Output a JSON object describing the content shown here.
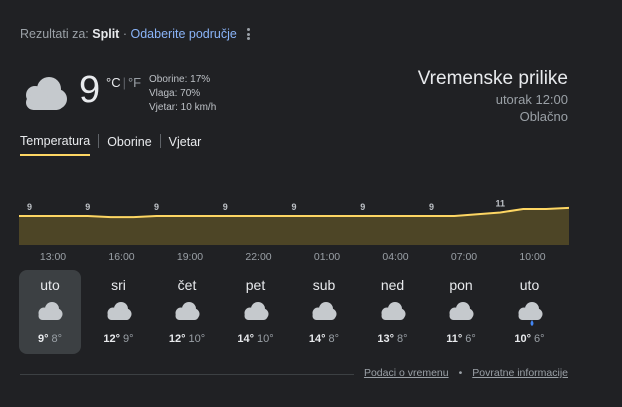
{
  "results": {
    "prefix": "Rezultati za:",
    "city": "Split",
    "separator": "·",
    "choose_area": "Odaberite područje"
  },
  "current": {
    "icon": "cloud-icon",
    "temperature": "9",
    "unit_c": "°C",
    "unit_f": "°F",
    "precipitation": "Oborine: 17%",
    "humidity": "Vlaga: 70%",
    "wind": "Vjetar: 10 km/h"
  },
  "header": {
    "title": "Vremenske prilike",
    "datetime": "utorak 12:00",
    "condition": "Oblačno"
  },
  "tabs": [
    {
      "label": "Temperatura",
      "active": true
    },
    {
      "label": "Oborine",
      "active": false
    },
    {
      "label": "Vjetar",
      "active": false
    }
  ],
  "chart_data": {
    "type": "area",
    "x": [
      "13:00",
      "14:00",
      "15:00",
      "16:00",
      "17:00",
      "18:00",
      "19:00",
      "20:00",
      "21:00",
      "22:00",
      "23:00",
      "00:00",
      "01:00",
      "02:00",
      "03:00",
      "04:00",
      "05:00",
      "06:00",
      "07:00",
      "08:00",
      "09:00",
      "10:00",
      "11:00",
      "12:00",
      "13:00"
    ],
    "series": [
      {
        "values": [
          9,
          9,
          9,
          9,
          8.7,
          8.7,
          9,
          9,
          9,
          9,
          9,
          9,
          9,
          9,
          9,
          9,
          9,
          9,
          9,
          9,
          9.5,
          10,
          11,
          11,
          11.3
        ]
      }
    ],
    "labels": [
      {
        "text": "9",
        "index": 0
      },
      {
        "text": "9",
        "index": 3
      },
      {
        "text": "9",
        "index": 6
      },
      {
        "text": "9",
        "index": 9
      },
      {
        "text": "9",
        "index": 12
      },
      {
        "text": "9",
        "index": 15
      },
      {
        "text": "9",
        "index": 18
      },
      {
        "text": "11",
        "index": 21
      }
    ],
    "tick_labels": [
      "13:00",
      "16:00",
      "19:00",
      "22:00",
      "01:00",
      "04:00",
      "07:00",
      "10:00"
    ],
    "colors": {
      "line": "#fdd663",
      "fill": "#4d4526"
    }
  },
  "days": [
    {
      "name": "uto",
      "icon": "cloud-icon",
      "hi": "9°",
      "lo": "8°",
      "selected": true
    },
    {
      "name": "sri",
      "icon": "cloud-icon",
      "hi": "12°",
      "lo": "9°",
      "selected": false
    },
    {
      "name": "čet",
      "icon": "cloud-icon",
      "hi": "12°",
      "lo": "10°",
      "selected": false
    },
    {
      "name": "pet",
      "icon": "cloud-icon",
      "hi": "14°",
      "lo": "10°",
      "selected": false
    },
    {
      "name": "sub",
      "icon": "cloud-icon",
      "hi": "14°",
      "lo": "8°",
      "selected": false
    },
    {
      "name": "ned",
      "icon": "cloud-icon",
      "hi": "13°",
      "lo": "8°",
      "selected": false
    },
    {
      "name": "pon",
      "icon": "cloud-icon",
      "hi": "11°",
      "lo": "6°",
      "selected": false
    },
    {
      "name": "uto",
      "icon": "cloud-rain-icon",
      "hi": "10°",
      "lo": "6°",
      "selected": false
    }
  ],
  "footer": {
    "link1": "Podaci o vremenu",
    "dot": "•",
    "link2": "Povratne informacije"
  },
  "colors": {
    "background": "#202124",
    "accent": "#fdd663",
    "link": "#8ab4f8",
    "rain": "#4285f4"
  }
}
